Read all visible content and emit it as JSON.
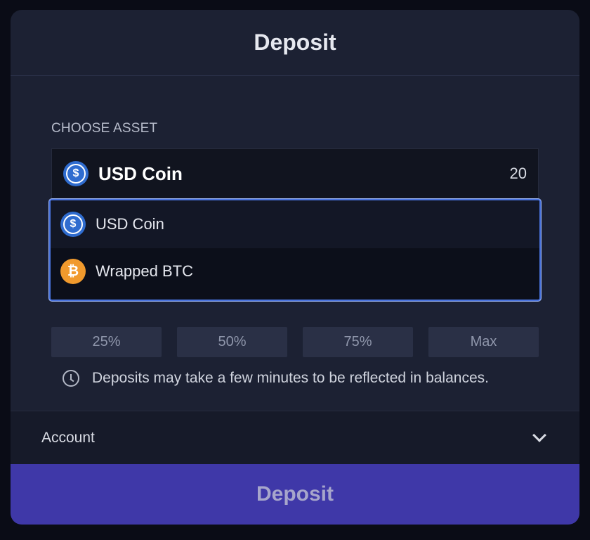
{
  "modal": {
    "title": "Deposit"
  },
  "asset": {
    "section_label": "CHOOSE ASSET",
    "selected": {
      "name": "USD Coin",
      "balance": "20",
      "icon": "usdc-icon"
    },
    "options": [
      {
        "name": "USD Coin",
        "icon": "usdc-icon",
        "highlighted": true
      },
      {
        "name": "Wrapped BTC",
        "icon": "btc-icon",
        "highlighted": false
      }
    ]
  },
  "percent_buttons": [
    "25%",
    "50%",
    "75%",
    "Max"
  ],
  "notice": {
    "text": "Deposits may take a few minutes to be reflected in balances.",
    "icon": "clock-icon"
  },
  "account": {
    "label": "Account",
    "icon": "chevron-down-icon"
  },
  "submit": {
    "label": "Deposit"
  },
  "colors": {
    "usdc": "#2f6ccf",
    "btc": "#f19a2d",
    "accent": "#3f38a8",
    "focus_border": "#4a74e0"
  }
}
